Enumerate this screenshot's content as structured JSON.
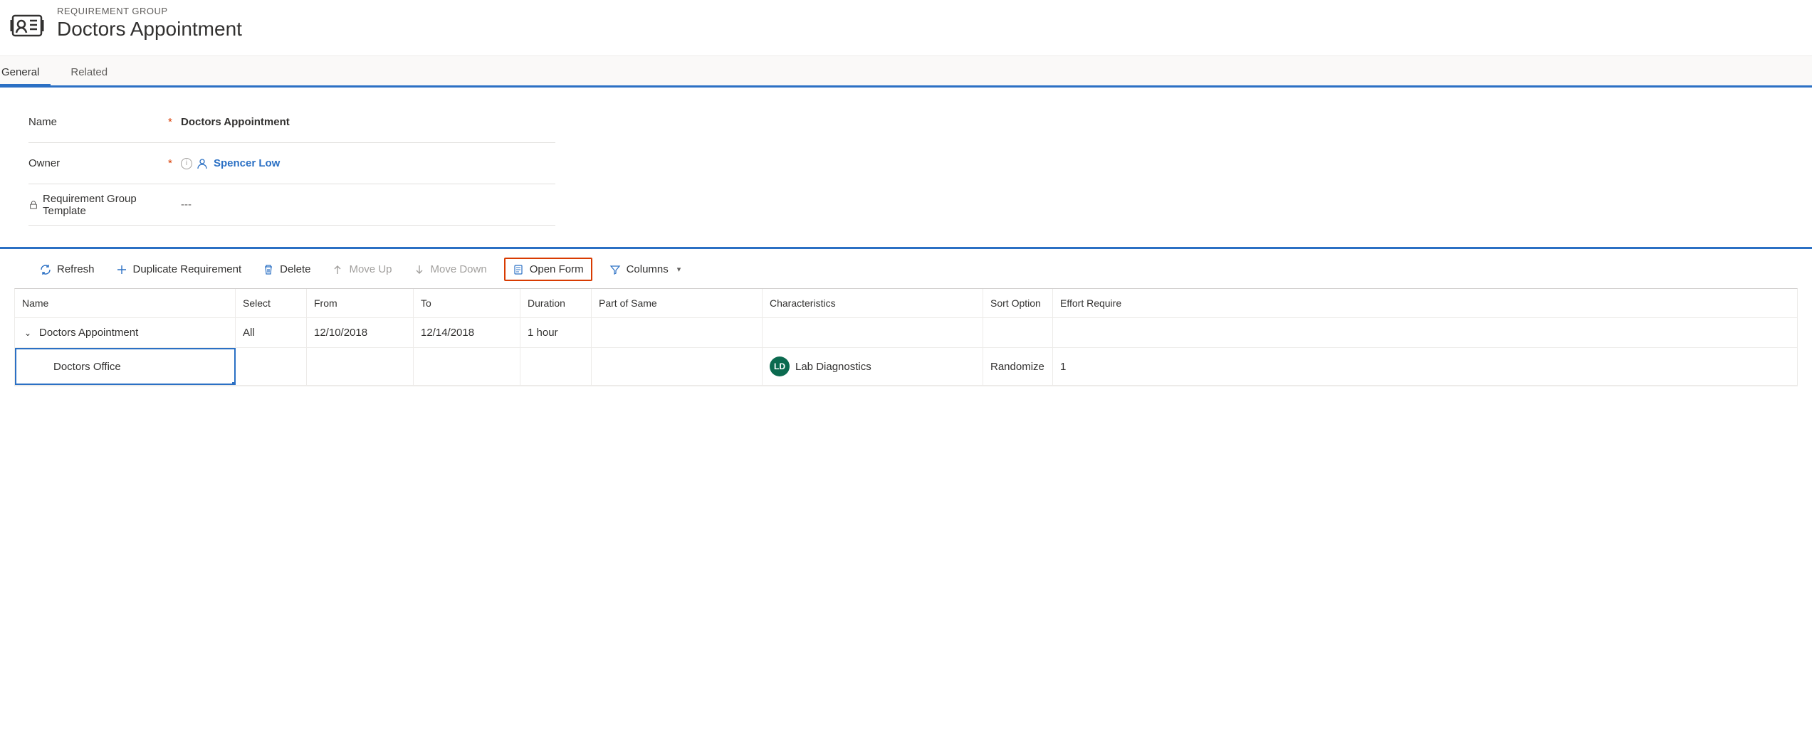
{
  "header": {
    "eyebrow": "REQUIREMENT GROUP",
    "title": "Doctors Appointment"
  },
  "tabs": [
    {
      "label": "General",
      "active": true
    },
    {
      "label": "Related",
      "active": false
    }
  ],
  "form": {
    "name": {
      "label": "Name",
      "value": "Doctors Appointment",
      "required": true
    },
    "owner": {
      "label": "Owner",
      "value": "Spencer Low",
      "required": true
    },
    "template": {
      "label": "Requirement Group Template",
      "value": "---",
      "locked": true
    }
  },
  "toolbar": {
    "refresh": "Refresh",
    "duplicate": "Duplicate Requirement",
    "delete": "Delete",
    "move_up": "Move Up",
    "move_down": "Move Down",
    "open_form": "Open Form",
    "columns": "Columns"
  },
  "grid": {
    "headers": {
      "name": "Name",
      "select": "Select",
      "from": "From",
      "to": "To",
      "duration": "Duration",
      "part_of_same": "Part of Same",
      "characteristics": "Characteristics",
      "sort_option": "Sort Option",
      "effort_required": "Effort Require"
    },
    "rows": [
      {
        "name": "Doctors Appointment",
        "select": "All",
        "from": "12/10/2018",
        "to": "12/14/2018",
        "duration": "1 hour",
        "part_of_same": "",
        "characteristics": "",
        "char_initials": "",
        "sort_option": "",
        "effort_required": "",
        "level": 0,
        "expanded": true,
        "selected": false
      },
      {
        "name": "Doctors Office",
        "select": "",
        "from": "",
        "to": "",
        "duration": "",
        "part_of_same": "",
        "characteristics": "Lab Diagnostics",
        "char_initials": "LD",
        "sort_option": "Randomize",
        "effort_required": "1",
        "level": 1,
        "expanded": false,
        "selected": true
      }
    ]
  }
}
